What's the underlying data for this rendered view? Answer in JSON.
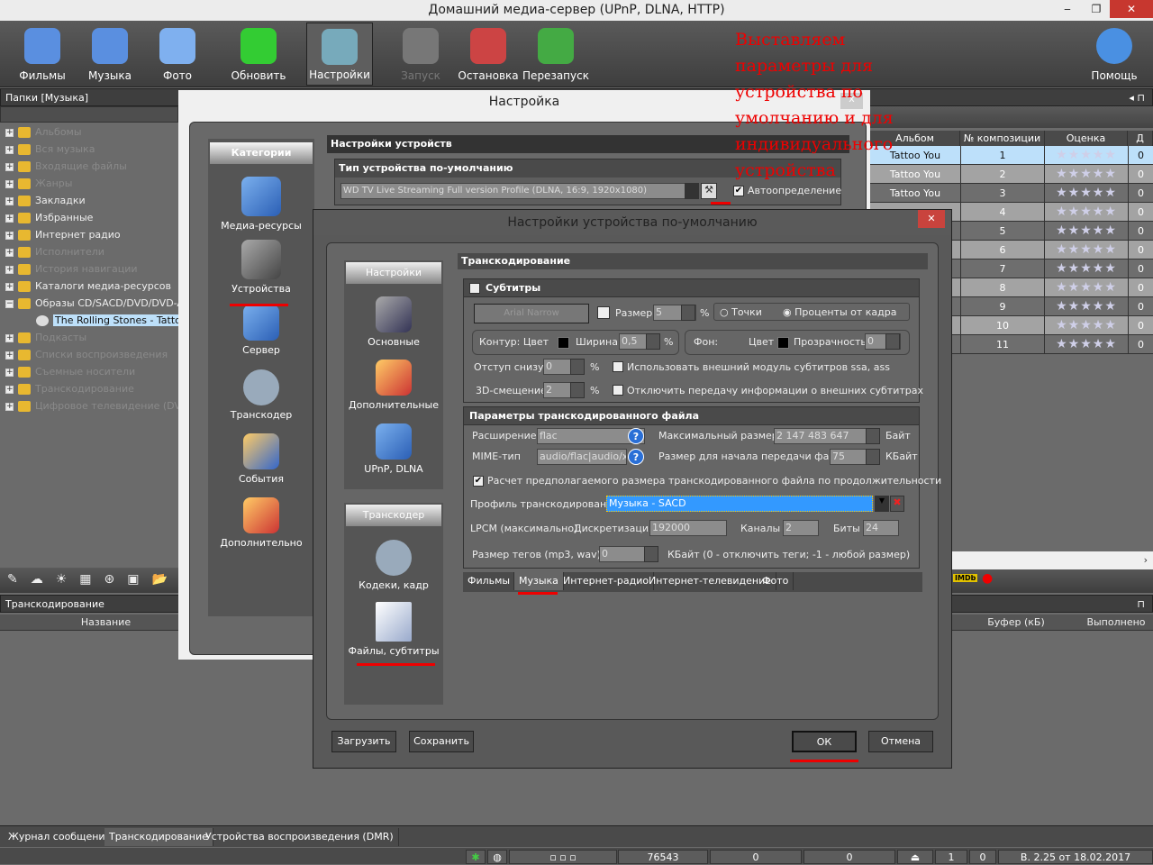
{
  "window": {
    "title": "Домашний медиа-сервер (UPnP, DLNA, HTTP)",
    "minimize": "‒",
    "maximize": "❐",
    "close": "✕"
  },
  "toolbar": {
    "items": [
      {
        "label": "Фильмы",
        "icon": "films-icon"
      },
      {
        "label": "Музыка",
        "icon": "music-icon"
      },
      {
        "label": "Фото",
        "icon": "photo-icon"
      },
      {
        "label": "Обновить",
        "icon": "refresh-icon"
      },
      {
        "label": "Настройки",
        "icon": "settings-icon",
        "active": true
      },
      {
        "label": "Запуск",
        "icon": "start-icon",
        "disabled": true
      },
      {
        "label": "Остановка",
        "icon": "stop-icon"
      },
      {
        "label": "Перезапуск",
        "icon": "restart-icon"
      },
      {
        "label": "Помощь",
        "icon": "help-icon"
      }
    ]
  },
  "annotation": "Выставляем\nпараметры для\nустройства по\nумолчанию и для\nиндивидуального\nустройства",
  "folders": {
    "title": "Папки [Музыка]",
    "items": [
      {
        "label": "Альбомы",
        "dim": true
      },
      {
        "label": "Вся музыка",
        "dim": true
      },
      {
        "label": "Входящие файлы",
        "dim": true
      },
      {
        "label": "Жанры",
        "dim": true
      },
      {
        "label": "Закладки"
      },
      {
        "label": "Избранные"
      },
      {
        "label": "Интернет радио"
      },
      {
        "label": "Исполнители",
        "dim": true
      },
      {
        "label": "История навигации",
        "dim": true
      },
      {
        "label": "Каталоги медиа-ресурсов"
      },
      {
        "label": "Образы CD/SACD/DVD/DVD-A/B"
      },
      {
        "label": "The Rolling Stones - Tattoo Y",
        "child": true,
        "selected": true
      },
      {
        "label": "Подкасты",
        "dim": true
      },
      {
        "label": "Списки воспроизведения",
        "dim": true
      },
      {
        "label": "Съемные носители",
        "dim": true
      },
      {
        "label": "Транскодирование",
        "dim": true
      },
      {
        "label": "Цифровое телевидение (DVB)",
        "dim": true
      }
    ]
  },
  "table": {
    "columns": [
      "Альбом",
      "№ композиции",
      "Оценка",
      "Д"
    ],
    "rows": [
      [
        "Tattoo You",
        "1"
      ],
      [
        "Tattoo You",
        "2"
      ],
      [
        "Tattoo You",
        "3"
      ],
      [
        "",
        "4"
      ],
      [
        "",
        "5"
      ],
      [
        "",
        "6"
      ],
      [
        "",
        "7"
      ],
      [
        "",
        "8"
      ],
      [
        "",
        "9"
      ],
      [
        "",
        "10"
      ],
      [
        "",
        "11"
      ]
    ],
    "rating_stars": "★★★★★",
    "last_col": "0"
  },
  "transcode_panel": {
    "title": "Транскодирование",
    "columns": [
      "Название",
      "Буфер (кБ)",
      "Выполнено"
    ]
  },
  "bottom_tabs": [
    "Журнал сообщений",
    "Транскодирование",
    "Устройства воспроизведения (DMR)"
  ],
  "status": {
    "count": "76543",
    "a": "0",
    "b": "0",
    "c": "1",
    "d": "0",
    "version": "В. 2.25 от 18.02.2017"
  },
  "settings_dialog": {
    "title": "Настройка",
    "close": "x",
    "categories_title": "Категории",
    "categories": [
      "Медиа-ресурсы",
      "Устройства",
      "Сервер",
      "Транскодер",
      "События",
      "Дополнительно"
    ],
    "devices_header": "Настройки устройств",
    "default_type_header": "Тип устройства по-умолчанию",
    "device_profile": "WD TV Live Streaming Full version Profile (DLNA, 16:9, 1920x1080)",
    "autodetect": "Автоопределение"
  },
  "device_dialog": {
    "title": "Настройки устройства по-умолчанию",
    "close": "✕",
    "nav_settings": "Настройки",
    "nav_items": [
      "Основные",
      "Дополнительные",
      "UPnP, DLNA"
    ],
    "nav_transcoder": "Транскодер",
    "nav_transcoder_items": [
      "Кодеки, кадр",
      "Файлы, субтитры"
    ],
    "section": "Транскодирование",
    "subs": {
      "title": "Субтитры",
      "font": "Arial Narrow",
      "size_label": "Размер",
      "size": "5",
      "pct": "%",
      "points": "Точки",
      "percent_frame": "Проценты от кадра",
      "outline": "Контур:",
      "color": "Цвет",
      "width_label": "Ширина",
      "width": "0,5",
      "bg": "Фон:",
      "transparency": "Прозрачность",
      "transparency_val": "0",
      "bottom_offset": "Отступ снизу",
      "bottom_offset_val": "0",
      "shift3d": "3D-смещение",
      "shift3d_val": "2",
      "ext_module": "Использовать внешний модуль субтитров ssa, ass",
      "disable_ext": "Отключить передачу информации о внешних субтитрах"
    },
    "file": {
      "title": "Параметры транскодированного файла",
      "ext_label": "Расширение",
      "ext": "flac",
      "mime_label": "MIME-тип",
      "mime": "audio/flac|audio/x-flac",
      "max_size_label": "Максимальный размер",
      "max_size": "2 147 483 647",
      "bytes": "Байт",
      "start_size_label": "Размер для начала передачи файла",
      "start_size": "75",
      "kb": "КБайт",
      "estimate": "Расчет предполагаемого размера транскодированного файла по продолжительности",
      "profile_label": "Профиль транскодирования",
      "profile": "Музыка - SACD",
      "lpcm": "LPCM (максимально):",
      "rate_label": "Дискретизация",
      "rate": "192000",
      "channels_label": "Каналы",
      "channels": "2",
      "bits_label": "Биты",
      "bits": "24",
      "tags_label": "Размер тегов (mp3, wav):",
      "tags": "0",
      "tags_hint": "КБайт (0 - отключить теги; -1 - любой размер)"
    },
    "tabs": [
      "Фильмы",
      "Музыка",
      "Интернет-радио",
      "Интернет-телевидение",
      "Фото"
    ],
    "load": "Загрузить",
    "save": "Сохранить",
    "ok": "ОК",
    "cancel": "Отмена"
  },
  "colors": {
    "annotation": "#e00000",
    "selection": "#3399ff",
    "row_selected": "#bde0fa"
  }
}
